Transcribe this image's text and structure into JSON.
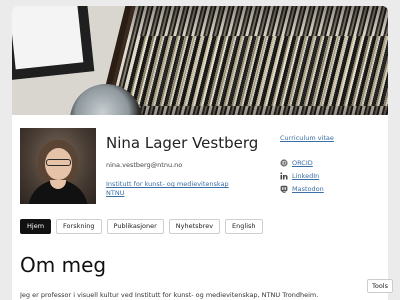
{
  "profile": {
    "name": "Nina Lager Vestberg",
    "email": "nina.vestberg@ntnu.no",
    "affiliation_line1": "Institutt for kunst- og medievitenskap",
    "affiliation_line2": "NTNU"
  },
  "links": {
    "cv": "Curriculum vitae",
    "social": [
      {
        "label": "ORCID",
        "icon": "orcid-icon"
      },
      {
        "label": "LinkedIn",
        "icon": "linkedin-icon"
      },
      {
        "label": "Mastodon",
        "icon": "mastodon-icon"
      }
    ]
  },
  "nav": {
    "tabs": [
      "Hjem",
      "Forskning",
      "Publikasjoner",
      "Nyhetsbrev",
      "English"
    ],
    "active": "Hjem"
  },
  "main": {
    "heading": "Om meg",
    "intro": "Jeg er professor i visuell kultur ved Institutt for kunst- og medievitenskap, NTNU Trondheim."
  },
  "tools_label": "Tools",
  "colors": {
    "link": "#3b6ea5",
    "active_tab": "#111111",
    "background": "#ebebeb"
  }
}
